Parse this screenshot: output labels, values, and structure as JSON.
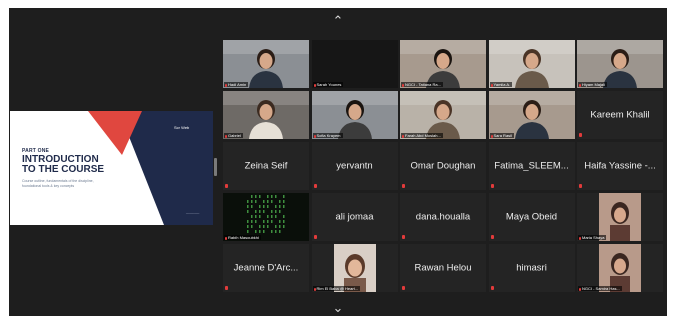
{
  "slide": {
    "part": "PART ONE",
    "title_line1": "INTRODUCTION",
    "title_line2": "TO THE COURSE",
    "subtitle": "Course outline, fundamentals of the discipline, foundational tools & key concepts",
    "logo": "Scr Web",
    "footer": "________"
  },
  "participants": [
    {
      "name": "Hadi Amin",
      "type": "video"
    },
    {
      "name": "Sarah Younes",
      "type": "dark"
    },
    {
      "name": "NGCI - Tatiana Ra...",
      "type": "video"
    },
    {
      "name": "Yamila A.",
      "type": "video"
    },
    {
      "name": "Hiyam Majali",
      "type": "video"
    },
    {
      "name": "Gabriel",
      "type": "video"
    },
    {
      "name": "Sofia Krayem",
      "type": "video"
    },
    {
      "name": "Farah Abd Moslah...",
      "type": "video"
    },
    {
      "name": "Sara Rasil",
      "type": "video"
    },
    {
      "name": "Kareem Khalil",
      "type": "name"
    },
    {
      "name": "Zeina Seif",
      "type": "name"
    },
    {
      "name": "yervantn",
      "type": "name"
    },
    {
      "name": "Omar Doughan",
      "type": "name"
    },
    {
      "name": "Fatima_SLEEM...",
      "type": "name"
    },
    {
      "name": "Haifa Yassine -...",
      "type": "name"
    },
    {
      "name": "Rabih Masoubkhi",
      "type": "matrix"
    },
    {
      "name": "ali jomaa",
      "type": "name"
    },
    {
      "name": "dana.houalla",
      "type": "name"
    },
    {
      "name": "Maya Obeid",
      "type": "name"
    },
    {
      "name": "Maria Shaya",
      "type": "photo"
    },
    {
      "name": "Jeanne D'Arc...",
      "type": "name"
    },
    {
      "name": "Rim El Baba @ Heart...",
      "type": "avatar"
    },
    {
      "name": "Rawan Helou",
      "type": "name"
    },
    {
      "name": "himasri",
      "type": "name"
    },
    {
      "name": "NGCI - Samira Has...",
      "type": "photo"
    }
  ],
  "active_speaker": "Sofia Krayem",
  "colors": {
    "background": "#1e1e1e",
    "tile": "#242424",
    "active_speaker_border": "#7ec244",
    "slide_navy": "#1f2a4a",
    "slide_red": "#e0473f",
    "muted_mic": "#e23b3b"
  },
  "icons": {
    "scroll_up": "chevron-up-icon",
    "scroll_down": "chevron-down-icon",
    "muted": "mic-muted-icon"
  }
}
